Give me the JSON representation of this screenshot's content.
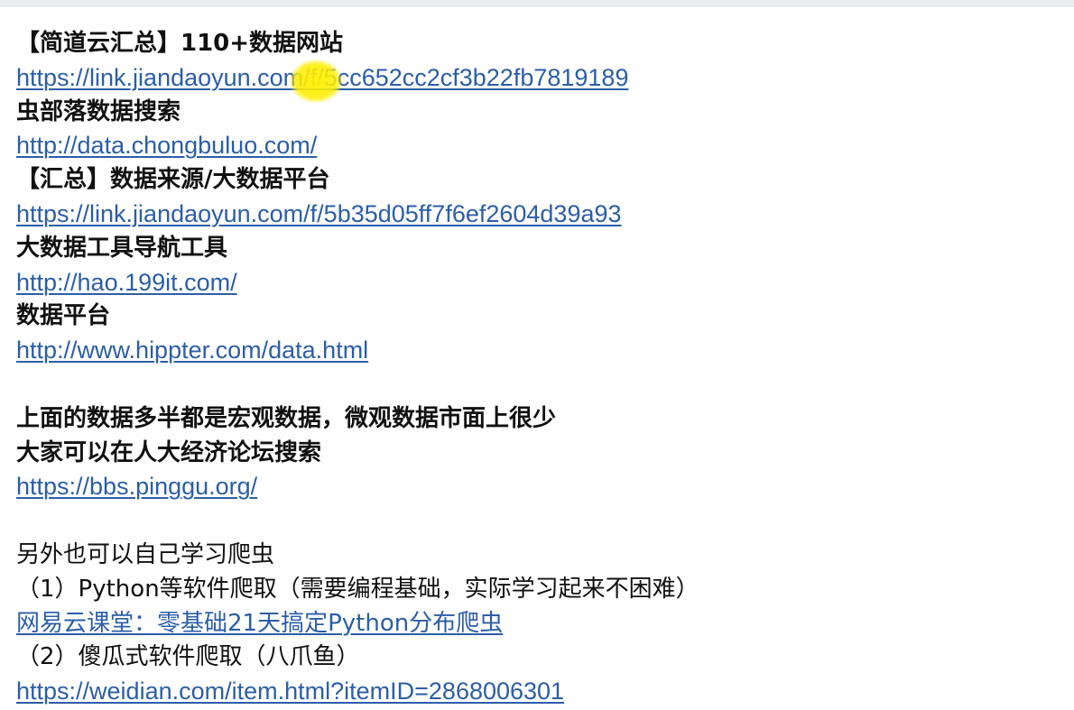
{
  "document": {
    "lines": [
      {
        "kind": "heading",
        "text": "【简道云汇总】110+数据网站"
      },
      {
        "kind": "link",
        "text": "https://link.jiandaoyun.com/f/5cc652cc2cf3b22fb7819189"
      },
      {
        "kind": "heading",
        "text": "虫部落数据搜索"
      },
      {
        "kind": "link",
        "text": "http://data.chongbuluo.com/"
      },
      {
        "kind": "heading",
        "text": "【汇总】数据来源/大数据平台"
      },
      {
        "kind": "link",
        "text": "https://link.jiandaoyun.com/f/5b35d05ff7f6ef2604d39a93"
      },
      {
        "kind": "heading",
        "text": "大数据工具导航工具"
      },
      {
        "kind": "link",
        "text": "http://hao.199it.com/"
      },
      {
        "kind": "heading",
        "text": "数据平台"
      },
      {
        "kind": "link",
        "text": "http://www.hippter.com/data.html"
      },
      {
        "kind": "blank",
        "text": ""
      },
      {
        "kind": "heading",
        "text": "上面的数据多半都是宏观数据，微观数据市面上很少"
      },
      {
        "kind": "heading",
        "text": "大家可以在人大经济论坛搜索"
      },
      {
        "kind": "link",
        "text": "https://bbs.pinggu.org/"
      },
      {
        "kind": "blank",
        "text": ""
      },
      {
        "kind": "normal",
        "text": "另外也可以自己学习爬虫"
      },
      {
        "kind": "normal",
        "text": "（1）Python等软件爬取（需要编程基础，实际学习起来不困难）"
      },
      {
        "kind": "link",
        "text": "网易云课堂：零基础21天搞定Python分布爬虫"
      },
      {
        "kind": "normal",
        "text": "（2）傻瓜式软件爬取（八爪鱼）"
      },
      {
        "kind": "link",
        "text": "https://weidian.com/item.html?itemID=2868006301"
      }
    ]
  },
  "colors": {
    "link": "#2b5ea8",
    "text": "#111111",
    "cursor_highlight": "#ffee00"
  }
}
